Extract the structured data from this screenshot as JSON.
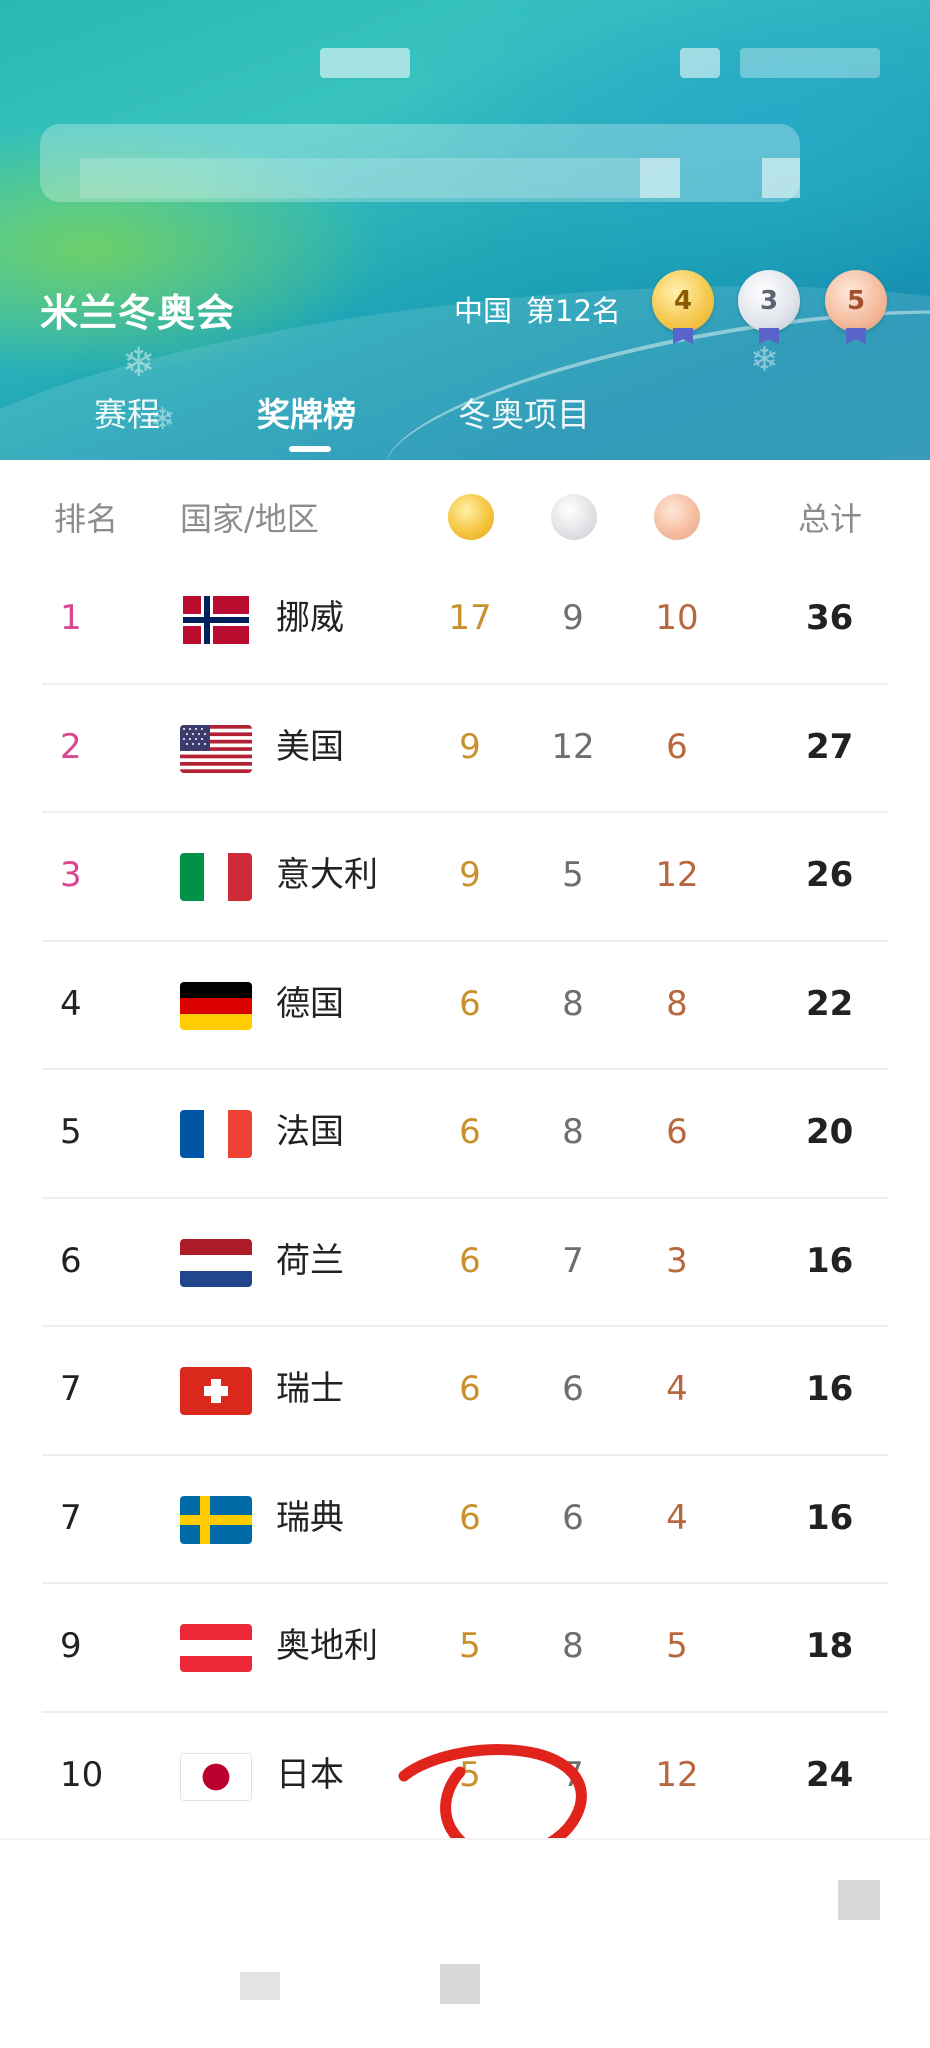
{
  "header": {
    "title": "米兰冬奥会",
    "country": "中国",
    "country_rank": "第12名",
    "medals": {
      "gold": "4",
      "silver": "3",
      "bronze": "5"
    }
  },
  "tabs": [
    {
      "label": "赛程",
      "active": false
    },
    {
      "label": "奖牌榜",
      "active": true
    },
    {
      "label": "冬奥项目",
      "active": false
    }
  ],
  "table": {
    "col_rank": "排名",
    "col_country": "国家/地区",
    "col_total": "总计",
    "medal_icons": [
      "gold-medal-icon",
      "silver-medal-icon",
      "bronze-medal-icon"
    ]
  },
  "rows": [
    {
      "rank": "1",
      "country": "挪威",
      "flag": "norway-flag-icon",
      "gold": "17",
      "silver": "9",
      "bronze": "10",
      "total": "36"
    },
    {
      "rank": "2",
      "country": "美国",
      "flag": "usa-flag-icon",
      "gold": "9",
      "silver": "12",
      "bronze": "6",
      "total": "27"
    },
    {
      "rank": "3",
      "country": "意大利",
      "flag": "italy-flag-icon",
      "gold": "9",
      "silver": "5",
      "bronze": "12",
      "total": "26"
    },
    {
      "rank": "4",
      "country": "德国",
      "flag": "germany-flag-icon",
      "gold": "6",
      "silver": "8",
      "bronze": "8",
      "total": "22"
    },
    {
      "rank": "5",
      "country": "法国",
      "flag": "france-flag-icon",
      "gold": "6",
      "silver": "8",
      "bronze": "6",
      "total": "20"
    },
    {
      "rank": "6",
      "country": "荷兰",
      "flag": "netherlands-flag-icon",
      "gold": "6",
      "silver": "7",
      "bronze": "3",
      "total": "16"
    },
    {
      "rank": "7",
      "country": "瑞士",
      "flag": "switzerland-flag-icon",
      "gold": "6",
      "silver": "6",
      "bronze": "4",
      "total": "16"
    },
    {
      "rank": "7",
      "country": "瑞典",
      "flag": "sweden-flag-icon",
      "gold": "6",
      "silver": "6",
      "bronze": "4",
      "total": "16"
    },
    {
      "rank": "9",
      "country": "奥地利",
      "flag": "austria-flag-icon",
      "gold": "5",
      "silver": "8",
      "bronze": "5",
      "total": "18"
    },
    {
      "rank": "10",
      "country": "日本",
      "flag": "japan-flag-icon",
      "gold": "5",
      "silver": "7",
      "bronze": "12",
      "total": "24"
    }
  ],
  "colors": {
    "top_rank": "#d9478f",
    "gold_text": "#c9902e",
    "silver_text": "#6e6e6e",
    "bronze_text": "#b8683f",
    "annotation_red": "#e0241c"
  }
}
